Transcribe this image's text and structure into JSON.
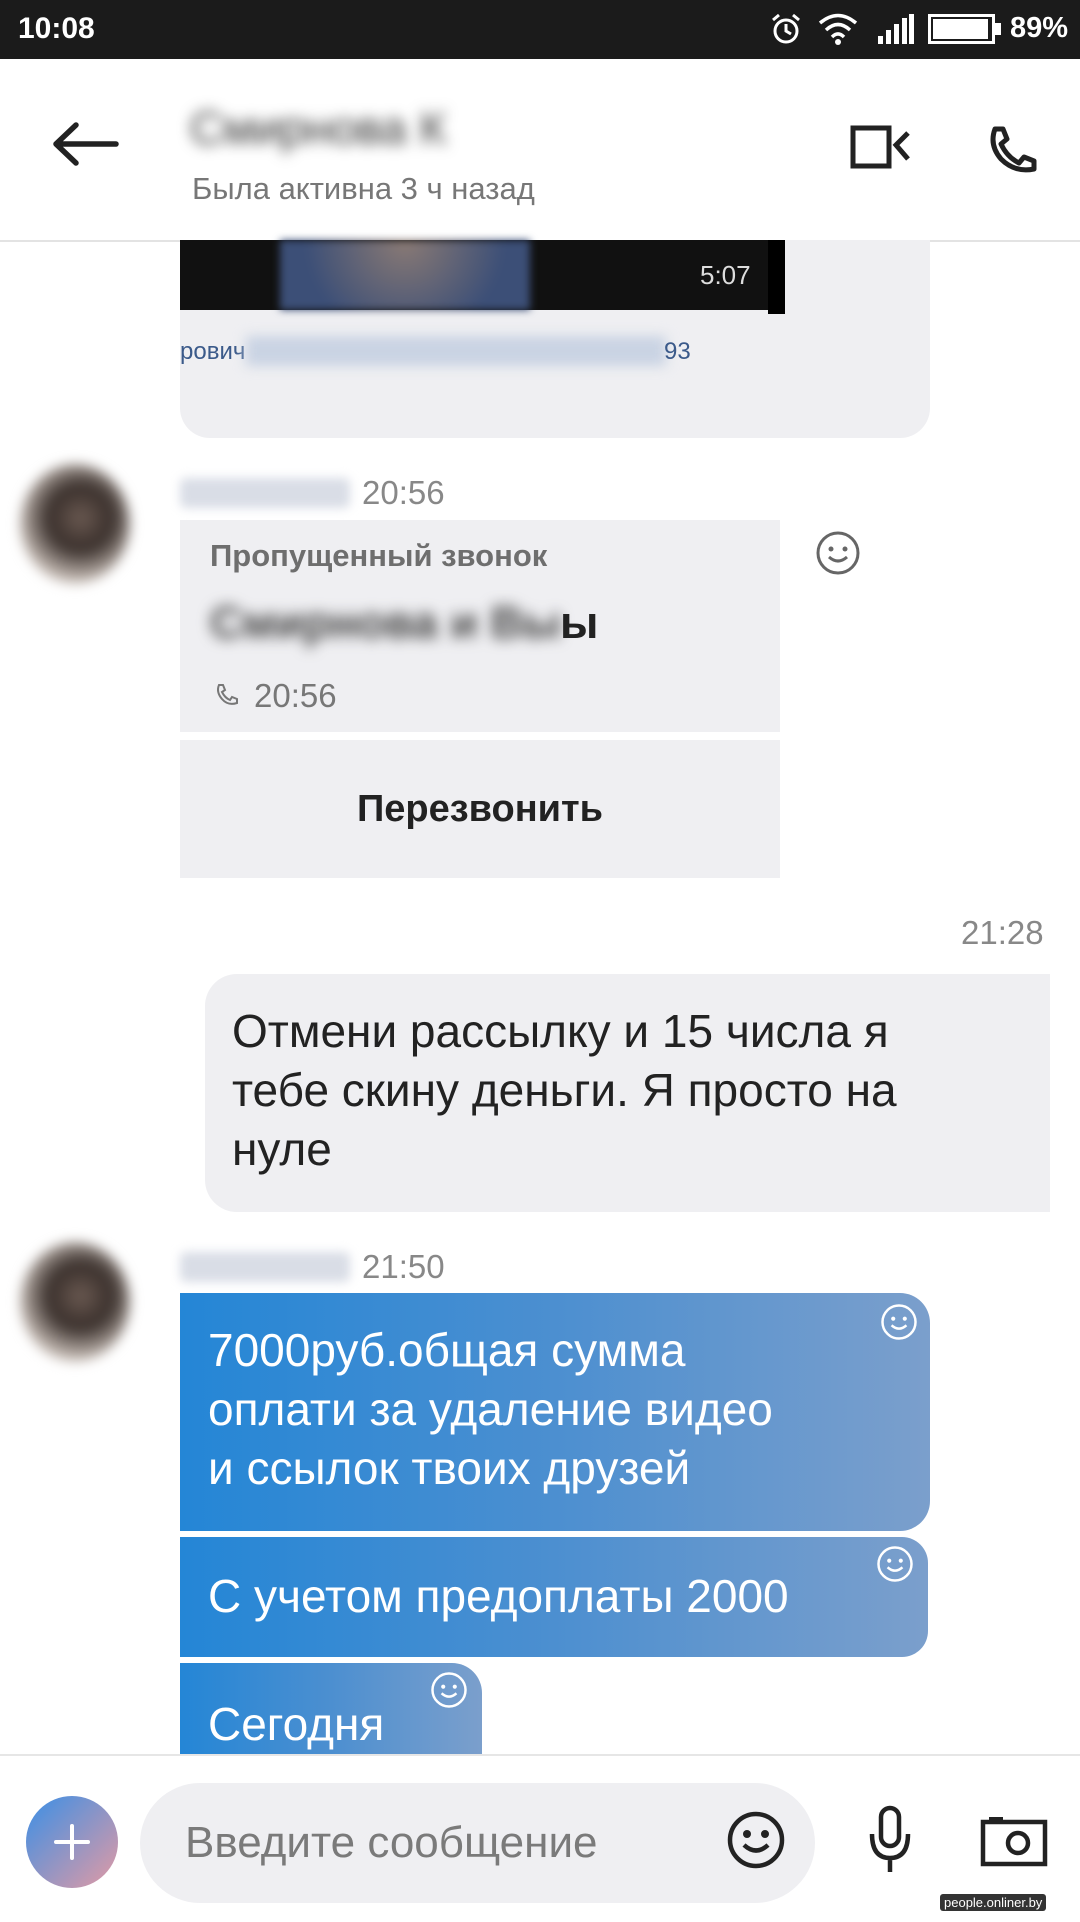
{
  "status_bar": {
    "time": "10:08",
    "battery_percent": "89%",
    "icons": [
      "alarm-icon",
      "wifi-icon",
      "signal-icon",
      "battery-icon"
    ]
  },
  "header": {
    "contact_name": "Смирнова К",
    "contact_status": "Была активна 3 ч назад",
    "icons": [
      "back-arrow-icon",
      "video-call-icon",
      "phone-call-icon"
    ]
  },
  "chat": {
    "media_preview": {
      "video_duration": "5:07",
      "link_text_left": "рович",
      "link_text_right": "93"
    },
    "missed_call": {
      "timestamp": "20:56",
      "title": "Пропущенный звонок",
      "caller": "Смирнова и Вы",
      "caller_tail": "ы",
      "call_time": "20:56",
      "callback_label": "Перезвонить"
    },
    "outgoing": {
      "timestamp": "21:28",
      "lines": [
        "Отмени рассылку и 15 числа я",
        "тебе скину деньги. Я просто на",
        "нуле"
      ]
    },
    "incoming": {
      "timestamp": "21:50",
      "msg1_lines": [
        "7000руб.общая сумма",
        "оплати за удаление видео",
        "и ссылок твоих друзей"
      ],
      "msg2": "С учетом предоплаты 2000",
      "msg3": "Сегодня"
    }
  },
  "composer": {
    "placeholder": "Введите сообщение",
    "icons": [
      "plus-icon",
      "emoji-icon",
      "microphone-icon",
      "camera-icon"
    ]
  },
  "watermark": "people.onliner.by",
  "colors": {
    "accent_blue": "#2486d6",
    "bubble_gray": "#efeff2",
    "status_bar": "#1b1b1b"
  }
}
